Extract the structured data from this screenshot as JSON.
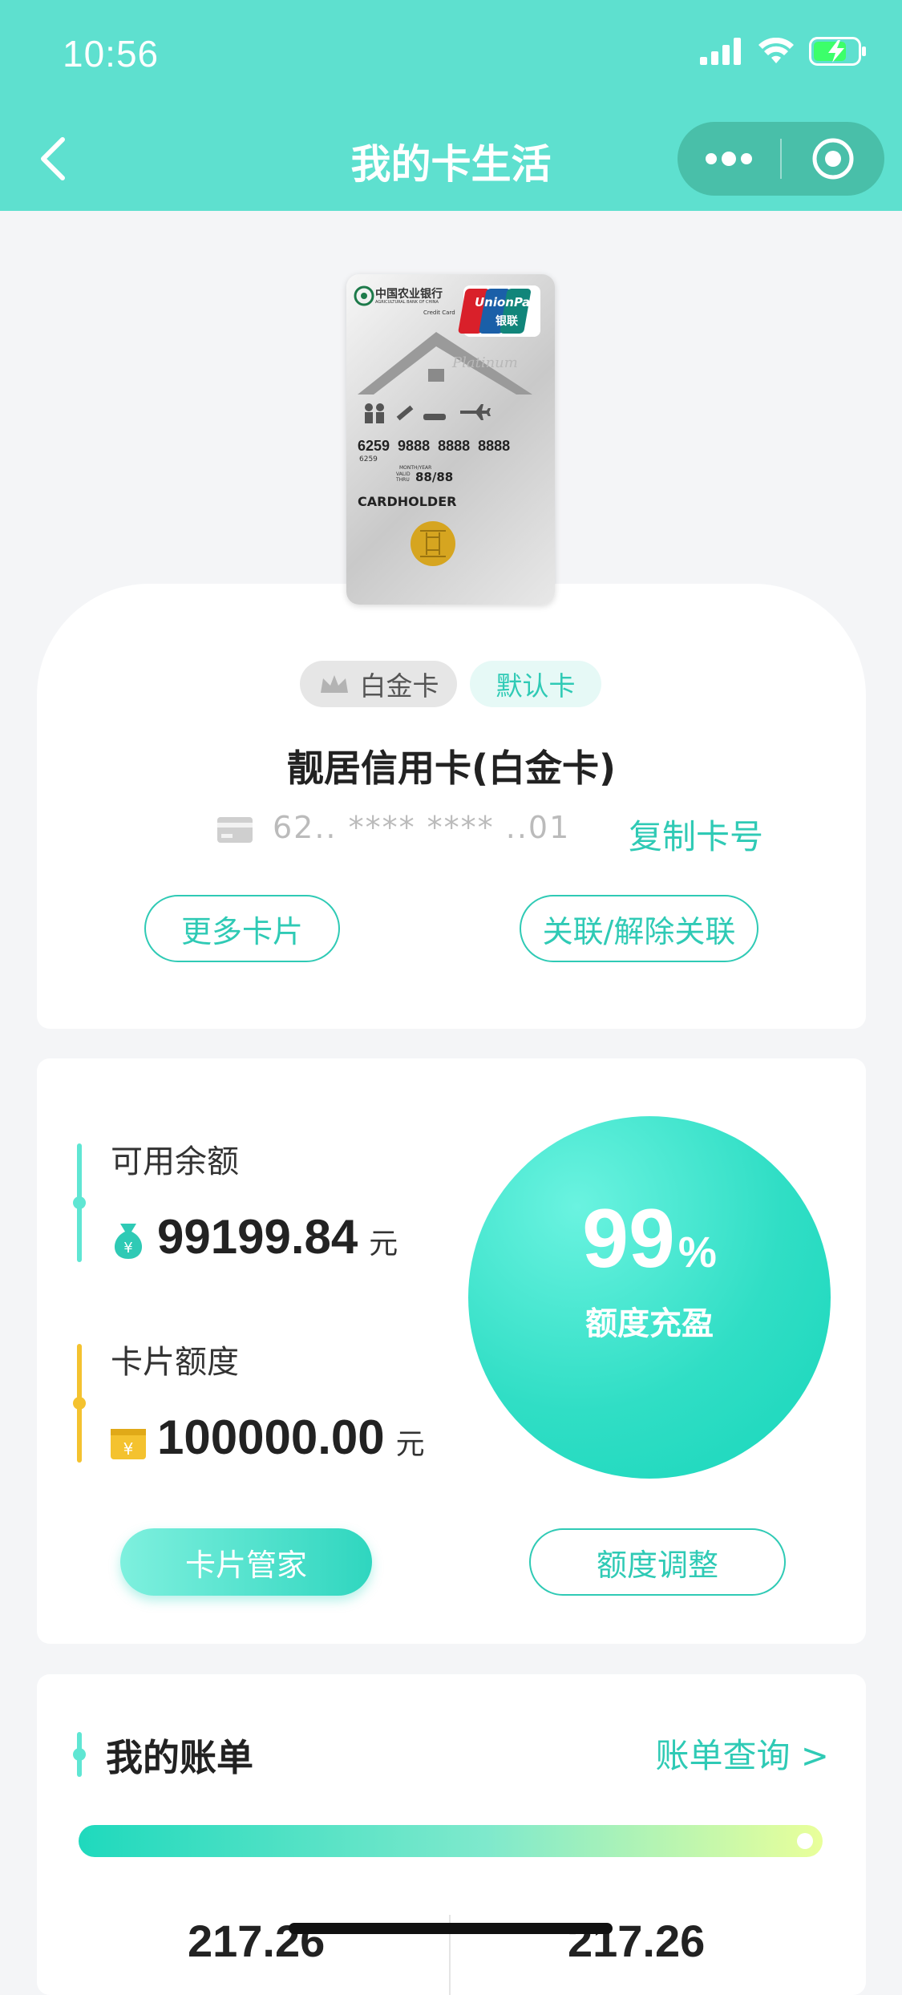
{
  "status_bar": {
    "time": "10:56"
  },
  "nav": {
    "title": "我的卡生活"
  },
  "card": {
    "tags": {
      "level": "白金卡",
      "default": "默认卡"
    },
    "name": "靓居信用卡(白金卡)",
    "number_masked": "62.. **** **** ..01",
    "copy_label": "复制卡号",
    "more_cards_label": "更多卡片",
    "link_label": "关联/解除关联",
    "image": {
      "bank_name": "中国农业银行",
      "bank_name_en": "AGRICULTURAL BANK OF CHINA",
      "credit_card_text": "Credit Card",
      "union_pay": "UnionPay",
      "union_pay_cn": "银联",
      "platinum_text": "Platinum",
      "number": "6259  9888  8888  8888",
      "number_small": "6259",
      "valid_header": "MONTH/YEAR",
      "valid_label": "VALID THRU",
      "expiry": "88/88",
      "holder": "CARDHOLDER"
    }
  },
  "limits": {
    "available_label": "可用余额",
    "available_value": "99199.84",
    "credit_label": "卡片额度",
    "credit_value": "100000.00",
    "unit": "元",
    "percent": "99",
    "percent_sign": "%",
    "percent_text": "额度充盈",
    "manager_button": "卡片管家",
    "adjust_button": "额度调整"
  },
  "bills": {
    "title": "我的账单",
    "query_link": "账单查询 >",
    "left_amount": "217.26",
    "right_amount": "217.26"
  },
  "colors": {
    "accent": "#2fcab5",
    "header": "#5ee0cf",
    "gold": "#f4c22f"
  }
}
